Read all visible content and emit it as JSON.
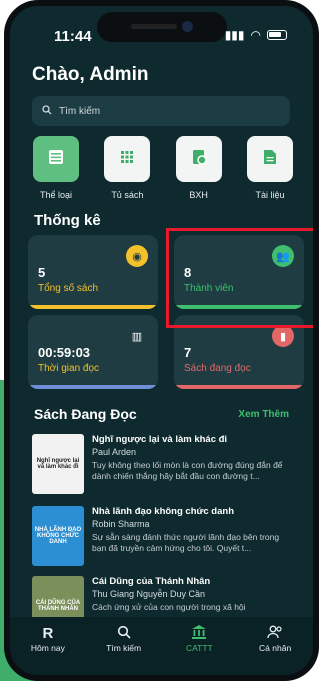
{
  "status": {
    "time": "11:44"
  },
  "greeting": "Chào, Admin",
  "search": {
    "placeholder": "Tìm kiếm"
  },
  "categories": [
    {
      "label": "Thể loại",
      "icon": "list-icon"
    },
    {
      "label": "Tủ sách",
      "icon": "grid-icon"
    },
    {
      "label": "BXH",
      "icon": "ranking-icon"
    },
    {
      "label": "Tài liệu",
      "icon": "document-icon"
    }
  ],
  "stats": {
    "title": "Thống kê",
    "cards": [
      {
        "value": "5",
        "label": "Tổng số sách",
        "color": "#f3c12c",
        "icon": "book-circle-icon"
      },
      {
        "value": "8",
        "label": "Thành viên",
        "color": "#3fbf6e",
        "icon": "users-icon"
      },
      {
        "value": "00:59:03",
        "label": "Thời gian đọc",
        "color": "#6c8fd8",
        "icon": "open-book-icon"
      },
      {
        "value": "7",
        "label": "Sách đang đọc",
        "color": "#e46767",
        "icon": "bookmark-icon"
      }
    ]
  },
  "reading": {
    "title": "Sách Đang Đọc",
    "more": "Xem Thêm",
    "books": [
      {
        "title": "Nghĩ ngược lại và làm khác đi",
        "author": "Paul Arden",
        "desc": "Tuy không theo lối mòn là con đường đúng đắn để dành chiến thắng hãy bắt đầu con đường t...",
        "cover": "Nghĩ ngược lại và làm khác đi"
      },
      {
        "title": "Nhà lãnh đạo không chức danh",
        "author": "Robin Sharma",
        "desc": "Sự sẵn sàng đánh thức người lãnh đạo bên trong bạn đã truyền cảm hứng cho tôi. Quyết t...",
        "cover": "NHÀ LÃNH ĐẠO KHÔNG CHỨC DANH"
      },
      {
        "title": "Cái Dũng của Thánh Nhân",
        "author": "Thu Giang Nguyễn Duy Cần",
        "desc": "Cách ứng xử của con người trong xã hội",
        "cover": "CÁI DŨNG CỦA THÁNH NHÂN"
      }
    ]
  },
  "nav": [
    {
      "label": "Hôm nay",
      "icon": "R"
    },
    {
      "label": "Tìm kiếm",
      "icon": "search-icon"
    },
    {
      "label": "CATTT",
      "icon": "library-icon"
    },
    {
      "label": "Cá nhân",
      "icon": "profile-icon"
    }
  ]
}
